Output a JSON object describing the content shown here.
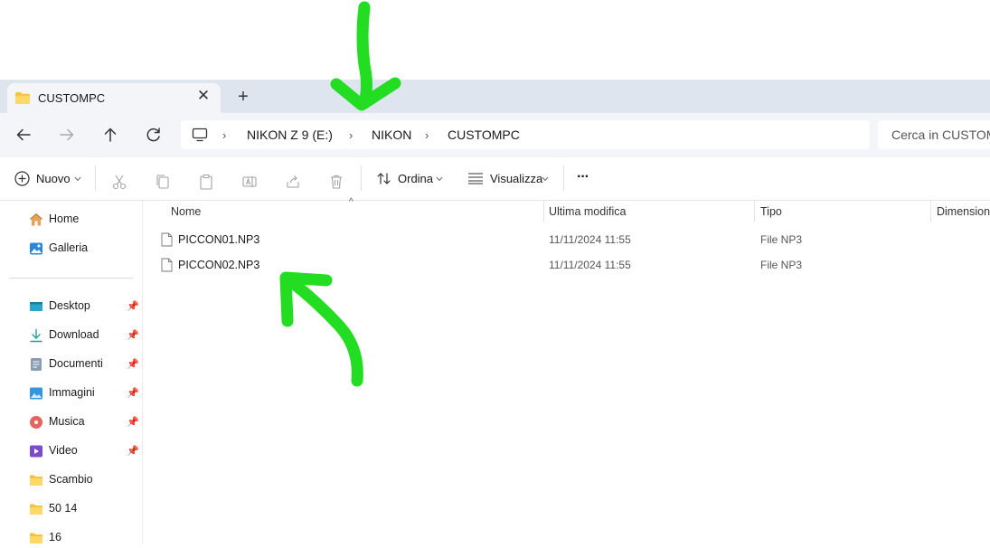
{
  "tab": {
    "title": "CUSTOMPC",
    "close_symbol": "✕",
    "new_tab_symbol": "+"
  },
  "nav": {
    "back": "back-arrow-icon",
    "forward": "forward-arrow-icon",
    "up": "up-arrow-icon",
    "refresh": "refresh-icon"
  },
  "breadcrumb": {
    "items": [
      "NIKON Z 9    (E:)",
      "NIKON",
      "CUSTOMPC"
    ],
    "separator": "›"
  },
  "search": {
    "placeholder": "Cerca in CUSTOMPC"
  },
  "toolbar": {
    "new_label": "Nuovo",
    "sort_label": "Ordina",
    "view_label": "Visualizza",
    "more_label": "···"
  },
  "sidebar": {
    "items": [
      {
        "label": "Home",
        "icon": "home-icon",
        "pinned": false
      },
      {
        "label": "Galleria",
        "icon": "gallery-icon",
        "pinned": false
      },
      {
        "label": "Desktop",
        "icon": "desktop-icon",
        "pinned": true
      },
      {
        "label": "Download",
        "icon": "download-icon",
        "pinned": true
      },
      {
        "label": "Documenti",
        "icon": "documents-icon",
        "pinned": true
      },
      {
        "label": "Immagini",
        "icon": "pictures-icon",
        "pinned": true
      },
      {
        "label": "Musica",
        "icon": "music-icon",
        "pinned": true
      },
      {
        "label": "Video",
        "icon": "video-icon",
        "pinned": true
      },
      {
        "label": "Scambio",
        "icon": "folder-icon",
        "pinned": false
      },
      {
        "label": "50 14",
        "icon": "folder-icon",
        "pinned": false
      },
      {
        "label": "16",
        "icon": "folder-icon",
        "pinned": false
      }
    ]
  },
  "columns": {
    "name": "Nome",
    "modified": "Ultima modifica",
    "type": "Tipo",
    "size": "Dimensione"
  },
  "files": [
    {
      "name": "PICCON01.NP3",
      "modified": "11/11/2024 11:55",
      "type": "File NP3"
    },
    {
      "name": "PICCON02.NP3",
      "modified": "11/11/2024 11:55",
      "type": "File NP3"
    }
  ],
  "colors": {
    "accent": "#0067c0",
    "annotation": "#22dd22",
    "folder": "#f5c244"
  }
}
